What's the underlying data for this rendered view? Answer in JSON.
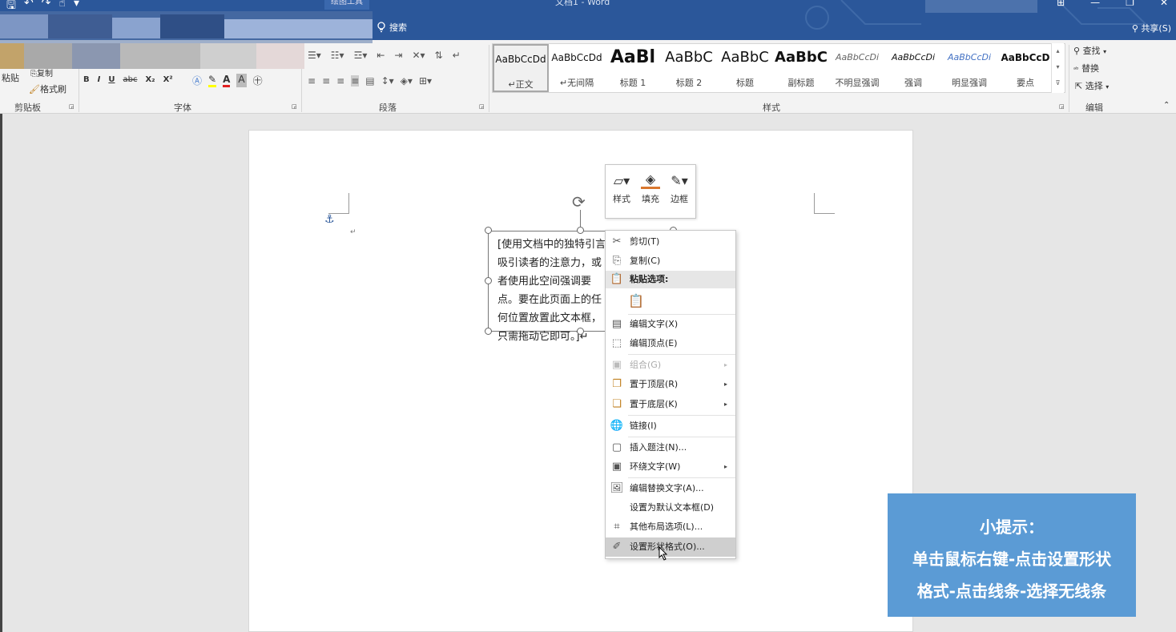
{
  "titlebar": {
    "qat_icons": [
      "save-icon",
      "undo-icon",
      "redo-icon",
      "customize-icon"
    ],
    "context_tab": "绘图工具",
    "doc_title": "文档1 - Word",
    "search_label": "搜索",
    "share_label": "共享(S)",
    "window_buttons": [
      "restore-ribbon-icon",
      "minimize-icon",
      "maximize-icon",
      "close-icon"
    ]
  },
  "ribbon": {
    "clipboard": {
      "paste": "粘贴",
      "copy": "复制",
      "format_painter": "格式刷",
      "label": "剪贴板"
    },
    "font": {
      "buttons": [
        "B",
        "I",
        "U",
        "abc",
        "X₂",
        "X²"
      ],
      "label": "字体"
    },
    "paragraph": {
      "label": "段落"
    },
    "styles": {
      "label": "样式",
      "items": [
        {
          "sample": "AaBbCcDd",
          "name": "↵正文"
        },
        {
          "sample": "AaBbCcDd",
          "name": "↵无间隔"
        },
        {
          "sample": "AaBl",
          "name": "标题 1"
        },
        {
          "sample": "AaBbC",
          "name": "标题 2"
        },
        {
          "sample": "AaBbC",
          "name": "标题"
        },
        {
          "sample": "AaBbC",
          "name": "副标题"
        },
        {
          "sample": "AaBbCcDi",
          "name": "不明显强调"
        },
        {
          "sample": "AaBbCcDi",
          "name": "强调"
        },
        {
          "sample": "AaBbCcDi",
          "name": "明显强调"
        },
        {
          "sample": "AaBbCcD",
          "name": "要点"
        }
      ]
    },
    "editing": {
      "find": "查找",
      "replace": "替换",
      "select": "选择",
      "label": "编辑"
    }
  },
  "document": {
    "textbox_text": "[使用文档中的独特引言吸引读者的注意力，或者使用此空间强调要点。要在此页面上的任何位置放置此文本框，只需拖动它即可。]↵",
    "para_mark": "↵"
  },
  "mini_toolbar": {
    "style": "样式",
    "fill": "填充",
    "border": "边框"
  },
  "context_menu": {
    "items": [
      {
        "icon": "scissors-icon",
        "label": "剪切(T)",
        "state": "normal",
        "submenu": false
      },
      {
        "icon": "copy-icon",
        "label": "复制(C)",
        "state": "normal",
        "submenu": false
      },
      {
        "icon": "paste-icon",
        "label": "粘贴选项:",
        "state": "header",
        "submenu": false
      },
      {
        "icon": "paste-text-only-icon",
        "label": "",
        "state": "normal",
        "submenu": false
      },
      {
        "icon": "edit-text-icon",
        "label": "编辑文字(X)",
        "state": "normal",
        "submenu": false
      },
      {
        "icon": "edit-points-icon",
        "label": "编辑顶点(E)",
        "state": "normal",
        "submenu": false
      },
      {
        "icon": "group-icon",
        "label": "组合(G)",
        "state": "disabled",
        "submenu": true
      },
      {
        "icon": "bring-front-icon",
        "label": "置于顶层(R)",
        "state": "normal",
        "submenu": true
      },
      {
        "icon": "send-back-icon",
        "label": "置于底层(K)",
        "state": "normal",
        "submenu": true
      },
      {
        "icon": "link-icon",
        "label": "链接(I)",
        "state": "normal",
        "submenu": false
      },
      {
        "icon": "insert-caption-icon",
        "label": "插入题注(N)...",
        "state": "normal",
        "submenu": false
      },
      {
        "icon": "wrap-text-icon",
        "label": "环绕文字(W)",
        "state": "normal",
        "submenu": true
      },
      {
        "icon": "alt-text-icon",
        "label": "编辑替换文字(A)...",
        "state": "normal",
        "submenu": false
      },
      {
        "icon": "",
        "label": "设置为默认文本框(D)",
        "state": "normal",
        "submenu": false
      },
      {
        "icon": "layout-options-icon",
        "label": "其他布局选项(L)...",
        "state": "normal",
        "submenu": false
      },
      {
        "icon": "format-shape-icon",
        "label": "设置形状格式(O)...",
        "state": "hover",
        "submenu": false
      }
    ]
  },
  "tip": {
    "title": "小提示：",
    "line1": "单击鼠标右键-点击设置形状",
    "line2": "格式-点击线条-选择无线条"
  },
  "colors": {
    "titlebar": "#2b579a",
    "tip_bg": "#5b9bd5",
    "font_color_red": "#e02020",
    "highlight_yellow": "#ffff00",
    "fill_orange": "#d9772e"
  }
}
